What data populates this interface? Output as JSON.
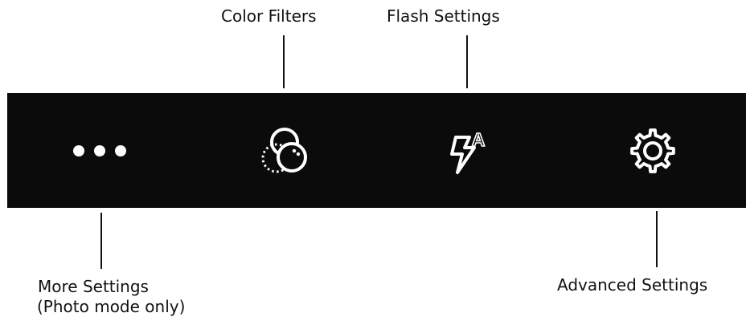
{
  "callouts": {
    "color_filters": "Color Filters",
    "flash_settings": "Flash Settings",
    "more_settings_line1": "More Settings",
    "more_settings_line2": "(Photo mode only)",
    "advanced_settings": "Advanced Settings"
  },
  "toolbar": {
    "background": "#0b0b0b",
    "icon_color": "#ffffff",
    "buttons": [
      {
        "icon": "more-dots-icon"
      },
      {
        "icon": "color-filters-icon"
      },
      {
        "icon": "flash-auto-icon",
        "badge": "A"
      },
      {
        "icon": "gear-icon"
      }
    ]
  }
}
